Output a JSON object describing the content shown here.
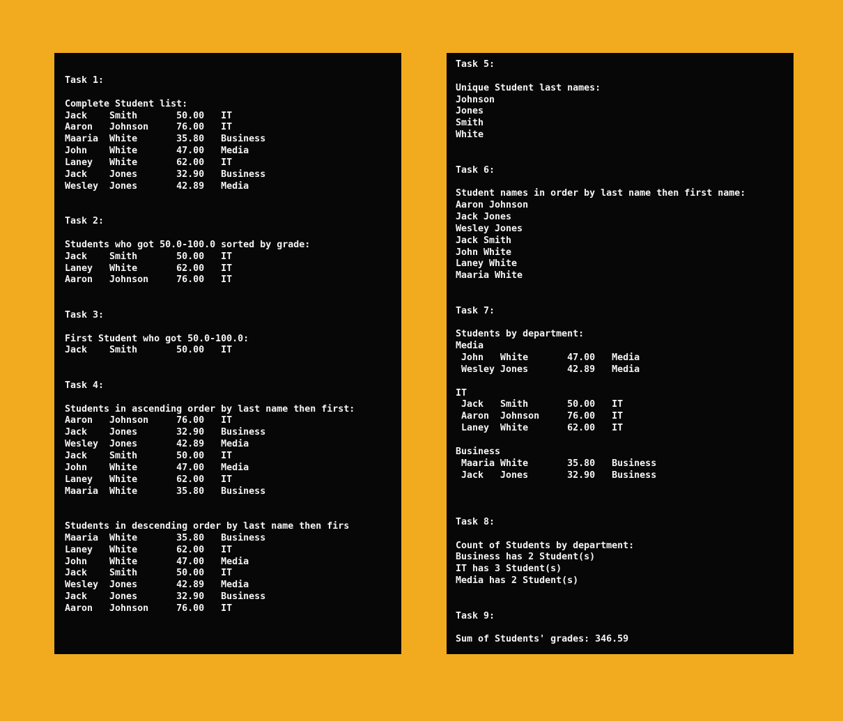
{
  "left_console": {
    "lines": [
      "Task 1:",
      "",
      "Complete Student list:",
      "Jack    Smith       50.00   IT",
      "Aaron   Johnson     76.00   IT",
      "Maaria  White       35.80   Business",
      "John    White       47.00   Media",
      "Laney   White       62.00   IT",
      "Jack    Jones       32.90   Business",
      "Wesley  Jones       42.89   Media",
      "",
      "",
      "Task 2:",
      "",
      "Students who got 50.0-100.0 sorted by grade:",
      "Jack    Smith       50.00   IT",
      "Laney   White       62.00   IT",
      "Aaron   Johnson     76.00   IT",
      "",
      "",
      "Task 3:",
      "",
      "First Student who got 50.0-100.0:",
      "Jack    Smith       50.00   IT",
      "",
      "",
      "Task 4:",
      "",
      "Students in ascending order by last name then first:",
      "Aaron   Johnson     76.00   IT",
      "Jack    Jones       32.90   Business",
      "Wesley  Jones       42.89   Media",
      "Jack    Smith       50.00   IT",
      "John    White       47.00   Media",
      "Laney   White       62.00   IT",
      "Maaria  White       35.80   Business",
      "",
      "",
      "Students in descending order by last name then firs",
      "Maaria  White       35.80   Business",
      "Laney   White       62.00   IT",
      "John    White       47.00   Media",
      "Jack    Smith       50.00   IT",
      "Wesley  Jones       42.89   Media",
      "Jack    Jones       32.90   Business",
      "Aaron   Johnson     76.00   IT"
    ]
  },
  "right_console": {
    "lines": [
      "Task 5:",
      "",
      "Unique Student last names:",
      "Johnson",
      "Jones",
      "Smith",
      "White",
      "",
      "",
      "Task 6:",
      "",
      "Student names in order by last name then first name:",
      "Aaron Johnson",
      "Jack Jones",
      "Wesley Jones",
      "Jack Smith",
      "John White",
      "Laney White",
      "Maaria White",
      "",
      "",
      "Task 7:",
      "",
      "Students by department:",
      "Media",
      " John   White       47.00   Media",
      " Wesley Jones       42.89   Media",
      "",
      "IT",
      " Jack   Smith       50.00   IT",
      " Aaron  Johnson     76.00   IT",
      " Laney  White       62.00   IT",
      "",
      "Business",
      " Maaria White       35.80   Business",
      " Jack   Jones       32.90   Business",
      "",
      "",
      "",
      "Task 8:",
      "",
      "Count of Students by department:",
      "Business has 2 Student(s)",
      "IT has 3 Student(s)",
      "Media has 2 Student(s)",
      "",
      "",
      "Task 9:",
      "",
      "Sum of Students' grades: 346.59"
    ]
  },
  "colors": {
    "background": "#f2aa1f",
    "console_background": "#070707",
    "console_text": "#f4f4f4"
  }
}
